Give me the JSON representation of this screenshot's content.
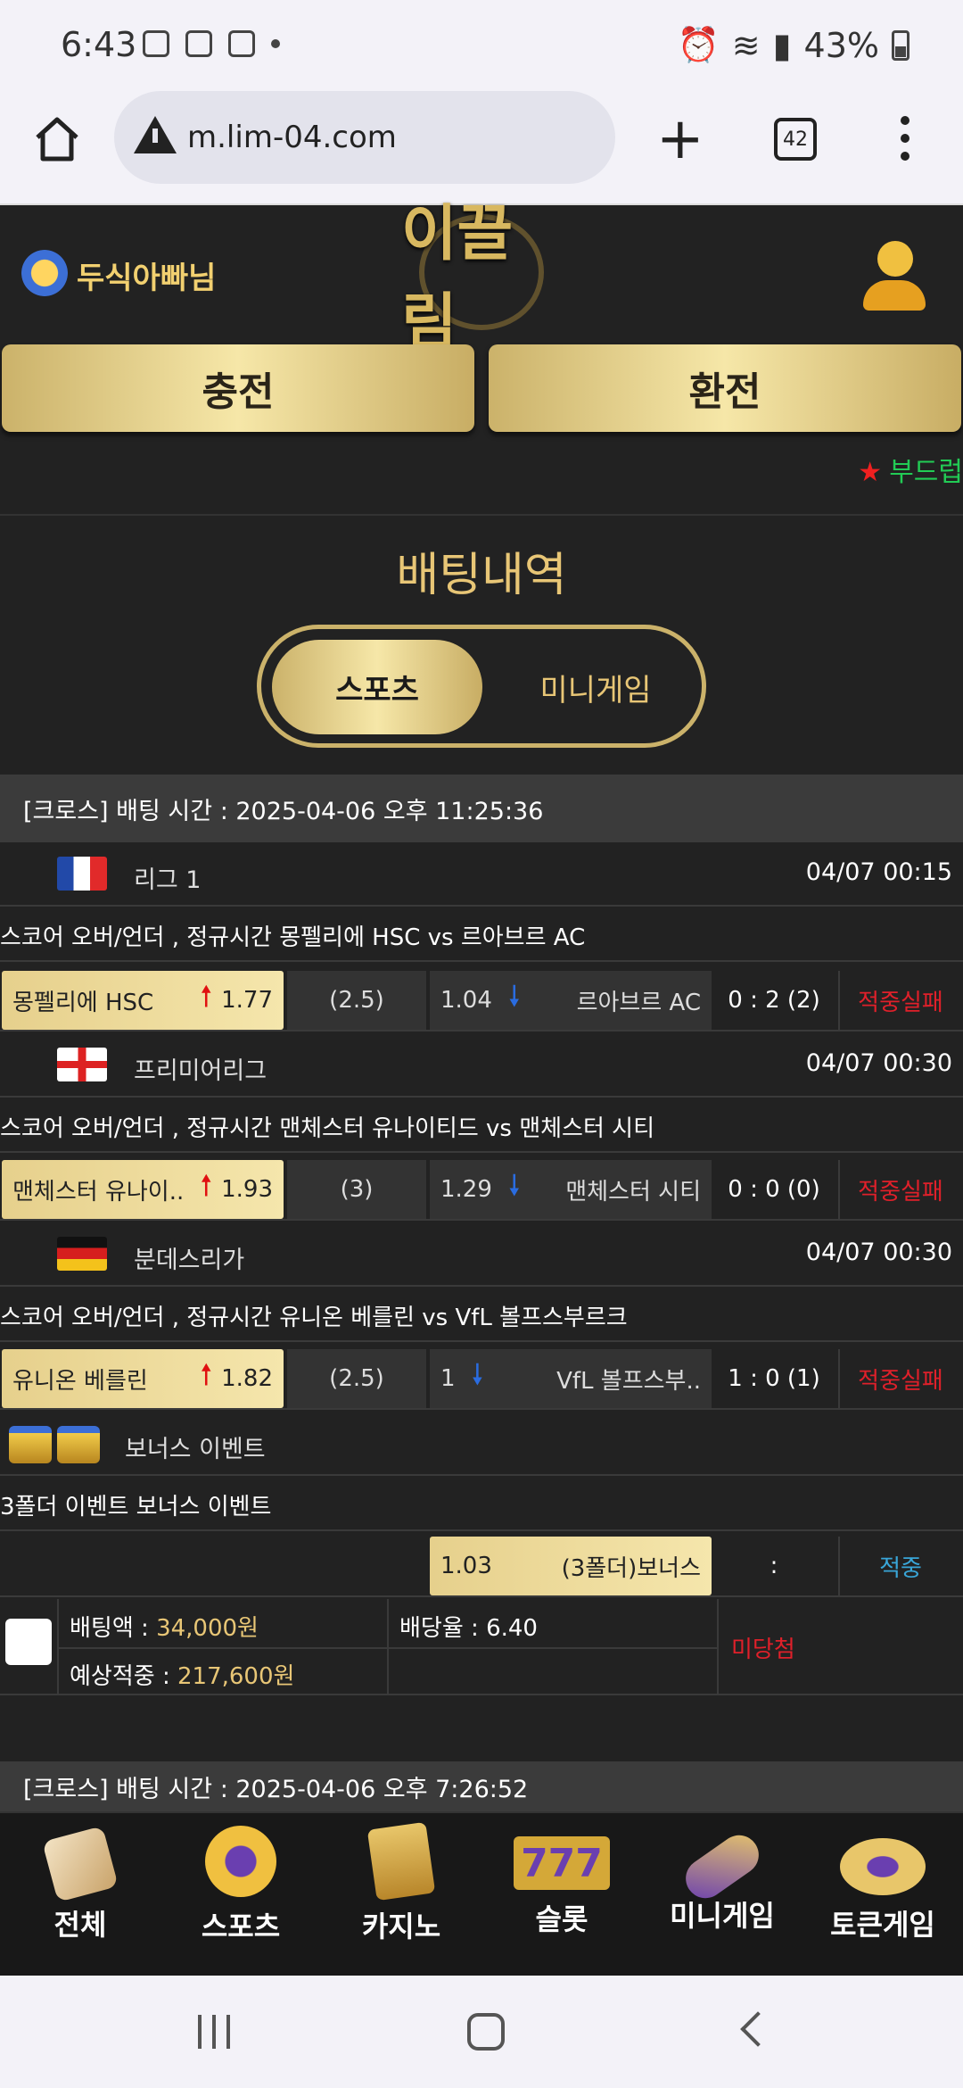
{
  "status": {
    "time": "6:43",
    "battery": "43%"
  },
  "browser": {
    "url": "m.lim-04.com",
    "tab_count": "42"
  },
  "header": {
    "username": "두식아빠님",
    "logo": "이끌림",
    "deposit_label": "충전",
    "withdraw_label": "환전"
  },
  "ticker": {
    "text": "부드럽"
  },
  "page": {
    "title": "배팅내역",
    "tab_sports": "스포츠",
    "tab_minigame": "미니게임"
  },
  "bet1": {
    "header": "[크로스] 배팅 시간 : 2025-04-06 오후 11:25:36",
    "games": [
      {
        "league": "리그 1",
        "date": "04/07 00:15",
        "desc": "스코어 오버/언더 , 정규시간 몽펠리에 HSC  vs  르아브르 AC",
        "home": "몽펠리에 HSC",
        "home_odds": "1.77",
        "handicap": "(2.5)",
        "away_odds": "1.04",
        "away": "르아브르 AC",
        "score": "0 : 2 (2)",
        "result": "적중실패"
      },
      {
        "league": "프리미어리그",
        "date": "04/07 00:30",
        "desc": "스코어 오버/언더 , 정규시간 맨체스터 유나이티드  vs  맨체스터 시티",
        "home": "맨체스터 유나이..",
        "home_odds": "1.93",
        "handicap": "(3)",
        "away_odds": "1.29",
        "away": "맨체스터 시티",
        "score": "0 : 0 (0)",
        "result": "적중실패"
      },
      {
        "league": "분데스리가",
        "date": "04/07 00:30",
        "desc": "스코어 오버/언더 , 정규시간 유니온 베를린  vs  VfL 볼프스부르크",
        "home": "유니온 베를린",
        "home_odds": "1.82",
        "handicap": "(2.5)",
        "away_odds": "1",
        "away": "VfL 볼프스부..",
        "score": "1 : 0 (1)",
        "result": "적중실패"
      }
    ],
    "bonus": {
      "league": "보너스 이벤트",
      "desc": "3폴더 이벤트 보너스 이벤트",
      "odds": "1.03",
      "name": "(3폴더)보너스",
      "score": ":",
      "result": "적중"
    },
    "summary": {
      "bet_label": "배팅액 : ",
      "bet_amount": "34,000원",
      "rate_label": "배당율 : ",
      "rate": "6.40",
      "expected_label": "예상적중 : ",
      "expected": "217,600원",
      "status": "미당첨"
    }
  },
  "bet2": {
    "header": "[크로스] 배팅 시간 : 2025-04-06 오후 7:26:52"
  },
  "nav": {
    "all": "전체",
    "sports": "스포츠",
    "casino": "카지노",
    "slot": "슬롯",
    "minigame": "미니게임",
    "token": "토큰게임"
  },
  "colors": {
    "gold": "#e8c676",
    "fail_red": "#e0202a",
    "hit_blue": "#39a6d8",
    "ticker_green": "#22cc55"
  }
}
